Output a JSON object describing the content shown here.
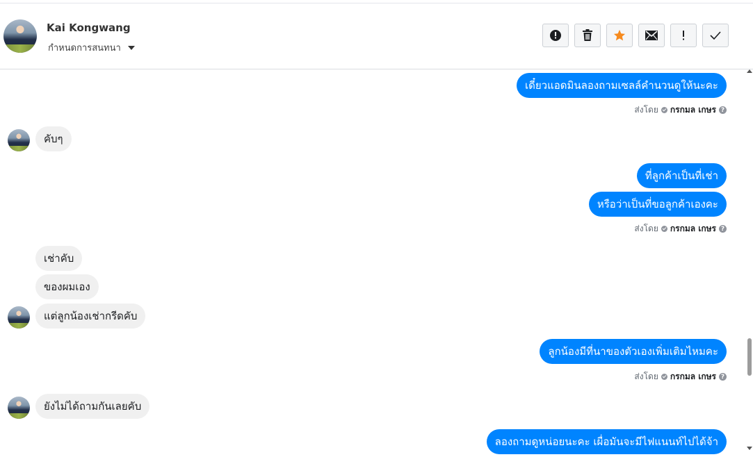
{
  "header": {
    "user_name": "Kai Kongwang",
    "assign_label": "กำหนดการสนทนา"
  },
  "actions": [
    {
      "name": "report-spam-button",
      "icon": "alert-circle-icon"
    },
    {
      "name": "delete-button",
      "icon": "trash-icon"
    },
    {
      "name": "star-button",
      "icon": "star-icon",
      "color": "#f68a1e"
    },
    {
      "name": "mark-unread-button",
      "icon": "envelope-icon"
    },
    {
      "name": "important-button",
      "icon": "exclamation-icon"
    },
    {
      "name": "mark-done-button",
      "icon": "check-icon"
    }
  ],
  "messages": [
    {
      "dir": "out",
      "text": "เดี๋ยวแอดมินลองถามเซลล์คำนวนดูให้นะคะ"
    },
    {
      "dir": "in",
      "text": "คับๆ"
    },
    {
      "dir": "out",
      "text": "ที่ลูกค้าเป็นที่เช่า"
    },
    {
      "dir": "out",
      "text": "หรือว่าเป็นที่ขอลูกค้าเองคะ"
    },
    {
      "dir": "in",
      "text": "เช่าคับ"
    },
    {
      "dir": "in",
      "text": "ของผมเอง"
    },
    {
      "dir": "in",
      "text": "แต่ลูกน้องเช่ากรีดคับ"
    },
    {
      "dir": "out",
      "text": "ลูกน้องมีที่นาของตัวเองเพิ่มเติมไหมคะ"
    },
    {
      "dir": "in",
      "text": "ยังไม่ได้ถามกันเลยคับ"
    },
    {
      "dir": "out",
      "text": "ลองถามดูหน่อยนะคะ เผื่อมันจะมีไฟแนนท์ไปได้จ้า"
    }
  ],
  "sent_by": {
    "prefix": "ส่งโดย",
    "name": "กรกมล เกษร",
    "help": "?"
  },
  "colors": {
    "outgoing": "#0084ff",
    "incoming": "#f0f0f0"
  }
}
